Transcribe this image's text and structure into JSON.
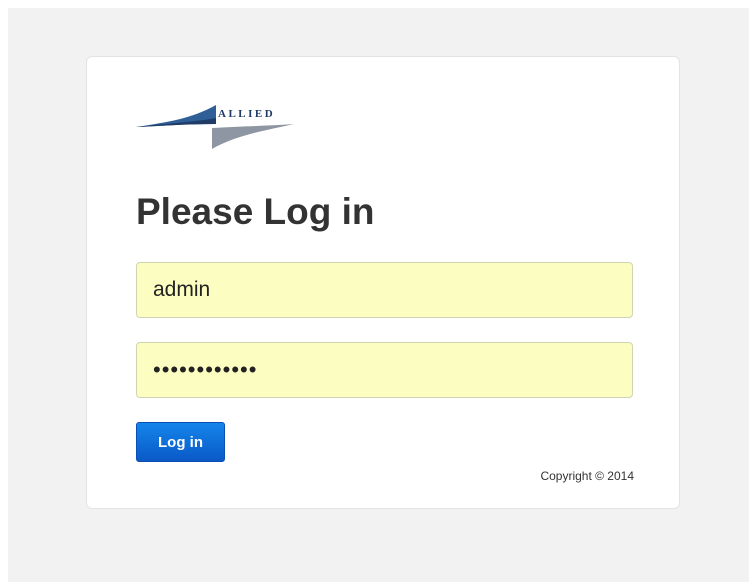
{
  "logo": {
    "text": "ALLIED",
    "colors": {
      "navy": "#1f3b66",
      "blue": "#2f5f96",
      "gray": "#8f96a3"
    }
  },
  "page_title": "Please Log in",
  "login_form": {
    "username_value": "admin",
    "password_value": "••••••••••••",
    "button_label": "Log in"
  },
  "footer": {
    "copyright": "Copyright © 2014"
  },
  "colors": {
    "page_background": "#f2f2f2",
    "card_background": "#ffffff",
    "input_background": "#fcfdc0",
    "button_blue": "#0a59c7"
  }
}
